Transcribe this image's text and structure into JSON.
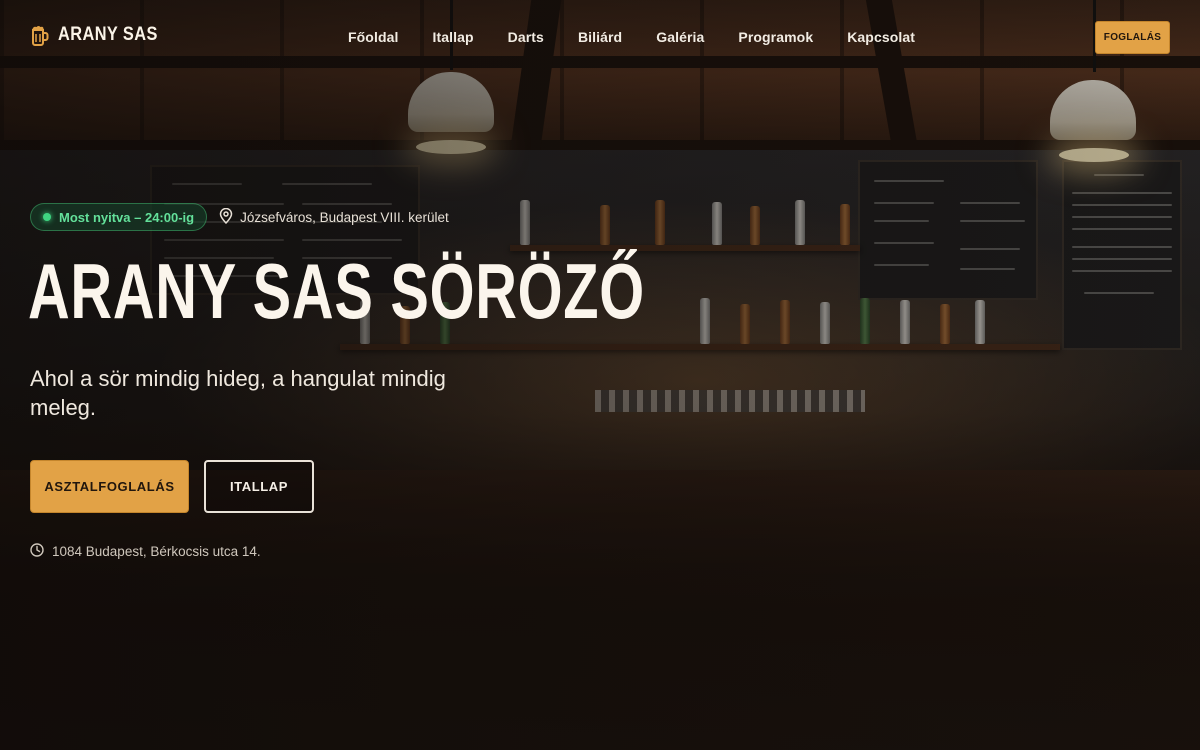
{
  "brand": {
    "name": "ARANY SAS",
    "icon": "beer-mug-icon",
    "accent_color": "#e2a246"
  },
  "nav": {
    "items": [
      {
        "label": "Főoldal"
      },
      {
        "label": "Itallap"
      },
      {
        "label": "Darts"
      },
      {
        "label": "Biliárd"
      },
      {
        "label": "Galéria"
      },
      {
        "label": "Programok"
      },
      {
        "label": "Kapcsolat"
      }
    ],
    "cta_label": "FOGLALÁS"
  },
  "hero": {
    "status_badge": "Most nyitva – 24:00-ig",
    "status_color": "#3fd481",
    "location": "Józsefváros, Budapest VIII. kerület",
    "location_icon": "map-pin-icon",
    "title": "ARANY SAS SÖRÖZŐ",
    "tagline": "Ahol a sör mindig hideg, a hangulat mindig meleg.",
    "primary_button": "ASZTALFOGLALÁS",
    "secondary_button": "ITALLAP",
    "address_icon": "clock-icon",
    "address": "1084 Budapest, Bérkocsis utca 14."
  }
}
